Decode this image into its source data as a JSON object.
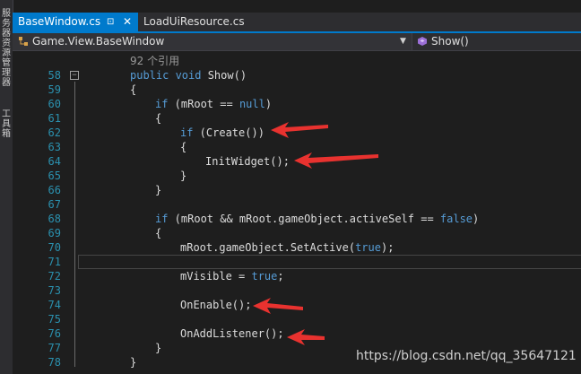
{
  "left_panel": {
    "label1": "服务器资源管理器",
    "label2": "工具箱"
  },
  "tabs": {
    "active_label": "BaseWindow.cs",
    "pin_glyph": "⊡",
    "close_glyph": "✕",
    "inactive_label": "LoadUiResource.cs"
  },
  "nav": {
    "class_path": "Game.View.BaseWindow",
    "member": "Show()"
  },
  "editor": {
    "codelens": "92 个引用",
    "lines": [
      {
        "n": "58",
        "text": "public void Show()"
      },
      {
        "n": "59",
        "text": "{"
      },
      {
        "n": "60",
        "text": "if (mRoot == null)"
      },
      {
        "n": "61",
        "text": "{"
      },
      {
        "n": "62",
        "text": "if (Create())"
      },
      {
        "n": "63",
        "text": "{"
      },
      {
        "n": "64",
        "text": "InitWidget();"
      },
      {
        "n": "65",
        "text": "}"
      },
      {
        "n": "66",
        "text": "}"
      },
      {
        "n": "67",
        "text": ""
      },
      {
        "n": "68",
        "text": "if (mRoot && mRoot.gameObject.activeSelf == false)"
      },
      {
        "n": "69",
        "text": "{"
      },
      {
        "n": "70",
        "text": "mRoot.gameObject.SetActive(true);"
      },
      {
        "n": "71",
        "text": ""
      },
      {
        "n": "72",
        "text": "mVisible = true;"
      },
      {
        "n": "73",
        "text": ""
      },
      {
        "n": "74",
        "text": "OnEnable();"
      },
      {
        "n": "75",
        "text": ""
      },
      {
        "n": "76",
        "text": "OnAddListener();"
      },
      {
        "n": "77",
        "text": "}"
      },
      {
        "n": "78",
        "text": "}"
      }
    ]
  },
  "colors": {
    "accent": "#007acc",
    "keyword": "#569cd6",
    "line_number": "#2b91af",
    "arrow": "#e8322f"
  },
  "watermark": "https://blog.csdn.net/qq_35647121"
}
